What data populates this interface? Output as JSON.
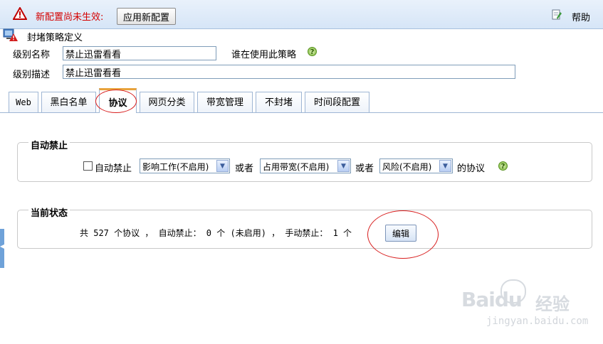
{
  "topbar": {
    "warning_text": "新配置尚未生效:",
    "apply_label": "应用新配置",
    "help_label": "帮助"
  },
  "page": {
    "title": "封堵策略定义"
  },
  "form": {
    "name_label": "级别名称",
    "name_value": "禁止迅雷看看",
    "who_uses_label": "谁在使用此策略",
    "desc_label": "级别描述",
    "desc_value": "禁止迅雷看看"
  },
  "tabs": [
    {
      "label": "Web"
    },
    {
      "label": "黑白名单"
    },
    {
      "label": "协议",
      "active": true
    },
    {
      "label": "网页分类"
    },
    {
      "label": "带宽管理"
    },
    {
      "label": "不封堵"
    },
    {
      "label": "时间段配置"
    }
  ],
  "auto_block": {
    "legend": "自动禁止",
    "checkbox_label": "自动禁止",
    "checked": false,
    "select1": "影响工作(不启用)",
    "or_label": "或者",
    "select2": "占用带宽(不启用)",
    "select3": "风险(不启用)",
    "suffix": "的协议"
  },
  "status": {
    "legend": "当前状态",
    "summary": "共 527 个协议 ， 自动禁止： 0 个 (未启用) ， 手动禁止： 1 个",
    "edit_label": "编辑"
  },
  "watermark": {
    "logo": "Baidu",
    "brand": "经验",
    "url": "jingyan.baidu.com"
  },
  "colors": {
    "warning": "#d40000",
    "annotation": "#d81e1e",
    "active_tab_accent": "#e8a33c"
  }
}
